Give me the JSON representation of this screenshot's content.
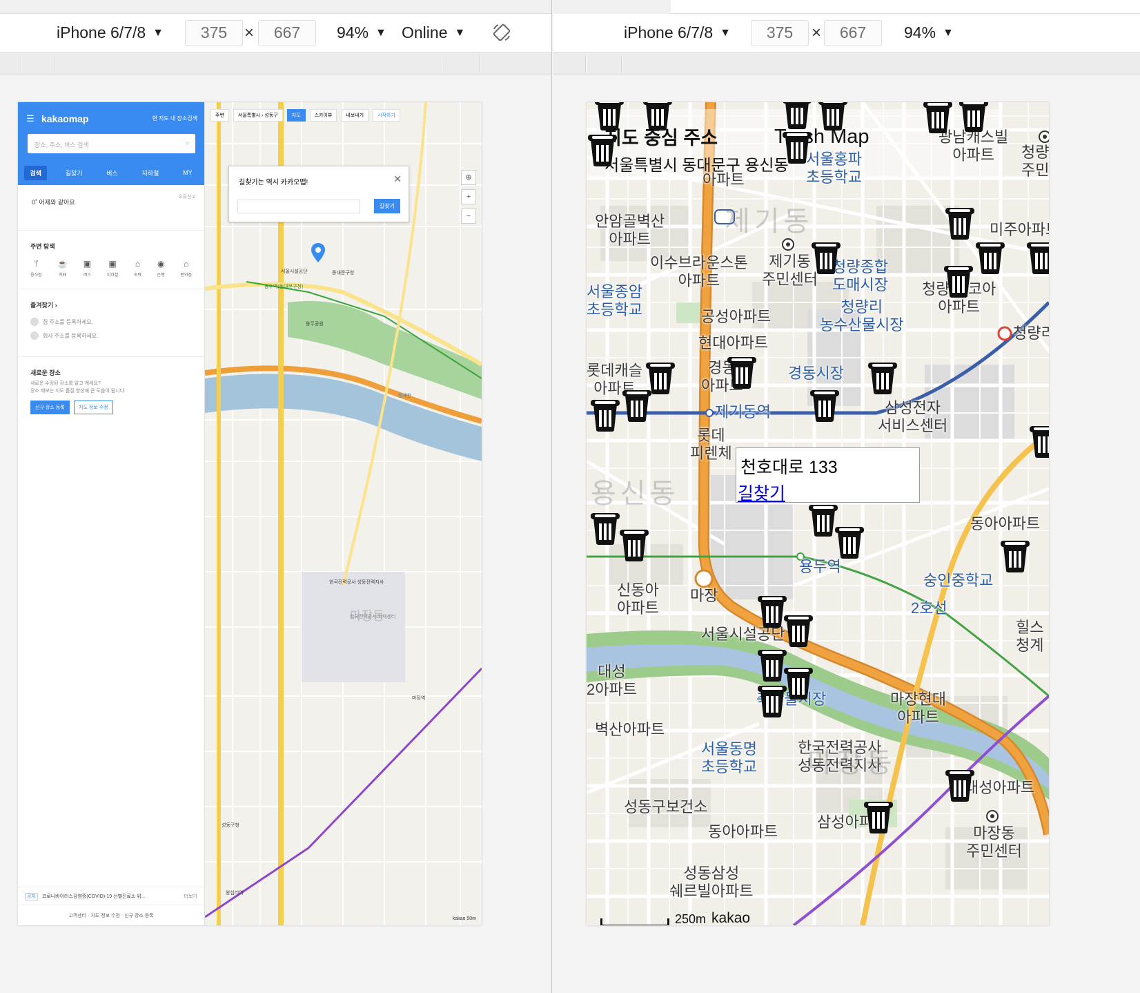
{
  "left_devtools": {
    "device": "iPhone 6/7/8",
    "width": "375",
    "height": "667",
    "zoom": "94%",
    "network": "Online",
    "times": "×"
  },
  "right_devtools": {
    "device": "iPhone 6/7/8",
    "width": "375",
    "height": "667",
    "zoom": "94%",
    "times": "×"
  },
  "kakao": {
    "brand": "kakaomap",
    "current_map_search": "현 지도 내 장소검색",
    "search_placeholder": "장소, 주소, 버스 검색",
    "tabs": [
      "검색",
      "길찾기",
      "버스",
      "지하철",
      "MY"
    ],
    "weather": "0˚  어제와 같아요",
    "weather_report": "오류신고",
    "nearby_title": "주변 탐색",
    "categories": [
      "음식점",
      "카페",
      "버스",
      "지하철",
      "숙박",
      "은행",
      "편의점"
    ],
    "favorites_title": "즐겨찾기 ›",
    "fav_home": "집 주소를 등록하세요.",
    "fav_work": "회사 주소를 등록하세요.",
    "new_place_title": "새로운 장소",
    "new_place_desc1": "새로운 수정된 장소를 알고 계세요?",
    "new_place_desc2": "장소 제보는 지도 품질 향상에 큰 도움이 됩니다.",
    "btn_register": "신규 장소 등록",
    "btn_edit": "지도 정보 수정",
    "notice_tag": "공지",
    "notice": "코로나바이러스감염증(COVID)-19 선별진료소 위...",
    "notice_more": "더보기",
    "footer": "고객센터 · 지도 정보 수정 · 신규 장소 등록",
    "map_top": [
      "주변",
      "서울특별시 › 성동구",
      "지도",
      "스카이뷰",
      "내보내기",
      "시작하기"
    ],
    "popup_title": "길찾기는 역시 카카오맵!",
    "popup_button": "길찾기",
    "map_labels": [
      "동대문구청",
      "용두공원",
      "서울시설공단",
      "마장동",
      "한국전력공사 성동전력지사",
      "성동구청",
      "용두역(동대문구청)",
      "청계천",
      "마장역",
      "왕십리역",
      "한국전력공사 자재센터"
    ],
    "scale": "kakao 50m"
  },
  "trash": {
    "info_title": "지도 중심 주소",
    "info_address": "서울특별시 동대문구 용신동",
    "brand": "Trash Map",
    "popup_address": "천호대로 133",
    "popup_link": "길찾기",
    "scale_text": "250m",
    "map_logo": "kakao",
    "labels": [
      {
        "t": "광남캐스빌\n아파트"
      },
      {
        "t": "청량\n주민"
      },
      {
        "t": "서울홍파\n초등학교",
        "c": "blue"
      },
      {
        "t": "아파트"
      },
      {
        "t": "안암골벽산\n아파트"
      },
      {
        "t": "이수브라운스톤\n아파트"
      },
      {
        "t": "제기동\n주민센터"
      },
      {
        "t": "청량종합\n도매시장",
        "c": "blue"
      },
      {
        "t": "미주아파트"
      },
      {
        "t": "청량리 코아\n아파트"
      },
      {
        "t": "서울종암\n초등학교",
        "c": "blue"
      },
      {
        "t": "공성아파트"
      },
      {
        "t": "청량리\n농수산물시장",
        "c": "blue"
      },
      {
        "t": "현대아파트"
      },
      {
        "t": "청량리"
      },
      {
        "t": "롯데캐슬\n아파트"
      },
      {
        "t": "경동\n아파트"
      },
      {
        "t": "경동시장",
        "c": "blue"
      },
      {
        "t": "삼성전자\n서비스센터"
      },
      {
        "t": "제기동역",
        "c": "blue"
      },
      {
        "t": "롯데\n피렌체"
      },
      {
        "t": "롯데아파트"
      },
      {
        "t": "동아아파트"
      },
      {
        "t": "신동아\n아파트"
      },
      {
        "t": "마장"
      },
      {
        "t": "용두역",
        "c": "blue"
      },
      {
        "t": "숭인중학교",
        "c": "blue"
      },
      {
        "t": "서울시설공단"
      },
      {
        "t": "2호선",
        "c": "blue"
      },
      {
        "t": "힐스\n청계"
      },
      {
        "t": "대성\n2아파트"
      },
      {
        "t": "축산물시장",
        "c": "blue"
      },
      {
        "t": "마장현대\n아파트"
      },
      {
        "t": "벽산아파트"
      },
      {
        "t": "서울동명\n초등학교",
        "c": "blue"
      },
      {
        "t": "한국전력공사\n성동전력지사"
      },
      {
        "t": "대성아파트"
      },
      {
        "t": "성동구보건소"
      },
      {
        "t": "삼성아파트"
      },
      {
        "t": "마장동\n주민센터"
      },
      {
        "t": "동아아파트"
      },
      {
        "t": "성동삼성\n쉐르빌아파트"
      },
      {
        "t": "제기동",
        "c": "big"
      },
      {
        "t": "용신동",
        "c": "big"
      },
      {
        "t": "마장동",
        "c": "big"
      }
    ],
    "bin_count": 32
  }
}
